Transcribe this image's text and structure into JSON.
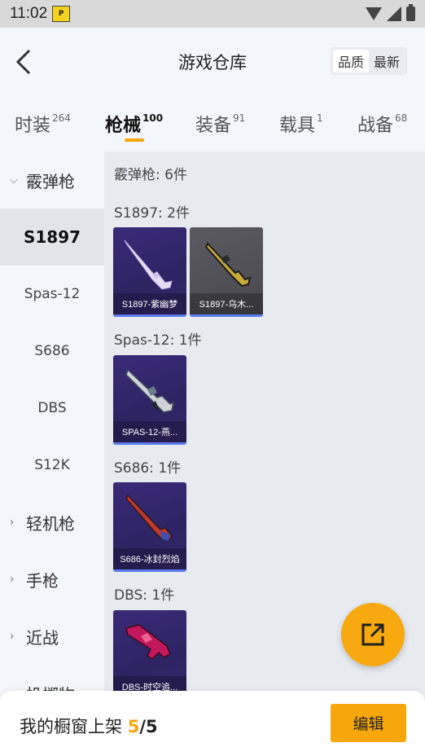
{
  "status_bar": {
    "time": "11:02",
    "app_badge": "P"
  },
  "header": {
    "title": "游戏仓库",
    "sort_options": [
      "品质",
      "最新"
    ]
  },
  "tabs": [
    {
      "label": "时装",
      "count": "264"
    },
    {
      "label": "枪械",
      "count": "100"
    },
    {
      "label": "装备",
      "count": "91"
    },
    {
      "label": "载具",
      "count": "1"
    },
    {
      "label": "战备",
      "count": "68"
    }
  ],
  "sidebar": {
    "items": [
      {
        "label": "霰弹枪"
      },
      {
        "label": "S1897"
      },
      {
        "label": "Spas-12"
      },
      {
        "label": "S686"
      },
      {
        "label": "DBS"
      },
      {
        "label": "S12K"
      },
      {
        "label": "轻机枪"
      },
      {
        "label": "手枪"
      },
      {
        "label": "近战"
      },
      {
        "label": "投掷物"
      }
    ]
  },
  "main": {
    "category_summary": "霰弹枪: 6件",
    "sections": [
      {
        "title": "S1897: 2件",
        "items": [
          {
            "label": "S1897-紫幽梦"
          },
          {
            "label": "S1897-乌木..."
          }
        ]
      },
      {
        "title": "Spas-12: 1件",
        "items": [
          {
            "label": "SPAS-12-燕..."
          }
        ]
      },
      {
        "title": "S686: 1件",
        "items": [
          {
            "label": "S686-冰封烈焰"
          }
        ]
      },
      {
        "title": "DBS: 1件",
        "items": [
          {
            "label": "DBS-时空追..."
          }
        ]
      }
    ]
  },
  "footer": {
    "showcase_label": "我的橱窗上架",
    "showcase_current": "5",
    "showcase_separator": "/",
    "showcase_total": "5",
    "edit_label": "编辑"
  },
  "colors": {
    "accent": "#f5a70b",
    "card_purple": "#3a2a78",
    "card_gray": "#55555b",
    "card_underline": "#5b7cf0"
  }
}
